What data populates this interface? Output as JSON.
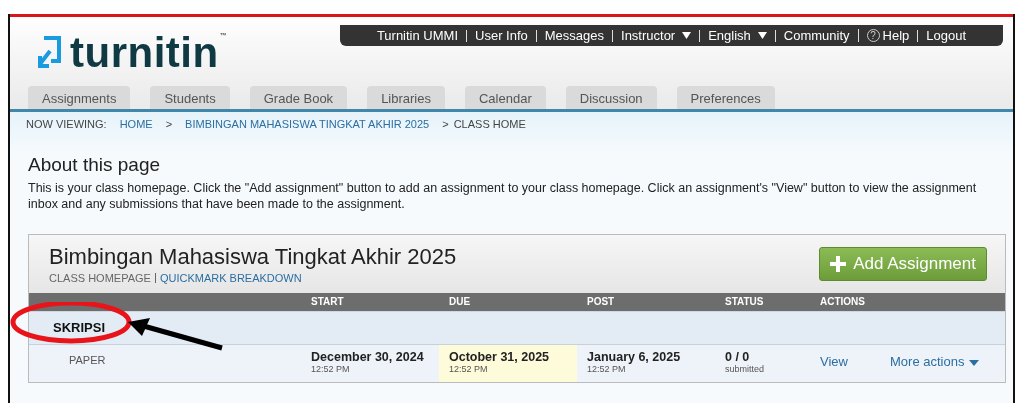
{
  "top_nav": [
    {
      "label": "Turnitin UMMI",
      "kind": "link"
    },
    {
      "label": "User Info",
      "kind": "link"
    },
    {
      "label": "Messages",
      "kind": "link"
    },
    {
      "label": "Instructor",
      "kind": "dropdown"
    },
    {
      "label": "English",
      "kind": "dropdown"
    },
    {
      "label": "Community",
      "kind": "link"
    },
    {
      "label": "Help",
      "kind": "help",
      "icon": "?"
    },
    {
      "label": "Logout",
      "kind": "link"
    }
  ],
  "logo": {
    "text": "turnitin",
    "mark": "™"
  },
  "tabs": [
    {
      "label": "Assignments",
      "selected": false
    },
    {
      "label": "Students",
      "selected": false
    },
    {
      "label": "Grade Book",
      "selected": false
    },
    {
      "label": "Libraries",
      "selected": false
    },
    {
      "label": "Calendar",
      "selected": false
    },
    {
      "label": "Discussion",
      "selected": false
    },
    {
      "label": "Preferences",
      "selected": false
    }
  ],
  "breadcrumb": {
    "prefix": "NOW VIEWING:",
    "separator": ">",
    "items": [
      {
        "label": "HOME",
        "kind": "link"
      },
      {
        "label": "BIMBINGAN MAHASISWA TINGKAT AKHIR 2025",
        "kind": "link"
      },
      {
        "label": "CLASS HOME",
        "kind": "current"
      }
    ]
  },
  "about": {
    "title": "About this page",
    "text": "This is your class homepage. Click the \"Add assignment\" button to add an assignment to your class homepage. Click an assignment's \"View\" button to view the assignment inbox and any submissions that have been made to the assignment."
  },
  "class_card": {
    "title": "Bimbingan Mahasiswa Tingkat Akhir 2025",
    "subtitle": "CLASS HOMEPAGE",
    "link": "QUICKMARK BREAKDOWN",
    "add_button": "Add Assignment",
    "columns": [
      "START",
      "DUE",
      "POST",
      "STATUS",
      "ACTIONS"
    ],
    "groups": [
      {
        "name": "SKRIPSI",
        "rows": [
          {
            "type": "PAPER",
            "start": {
              "date": "December 30, 2024",
              "time": "12:52 PM"
            },
            "due": {
              "date": "October 31, 2025",
              "time": "12:52 PM"
            },
            "post": {
              "date": "January 6, 2025",
              "time": "12:52 PM"
            },
            "status": "0 / 0",
            "status_note": "submitted",
            "view": "View",
            "more": "More actions"
          }
        ]
      }
    ]
  }
}
